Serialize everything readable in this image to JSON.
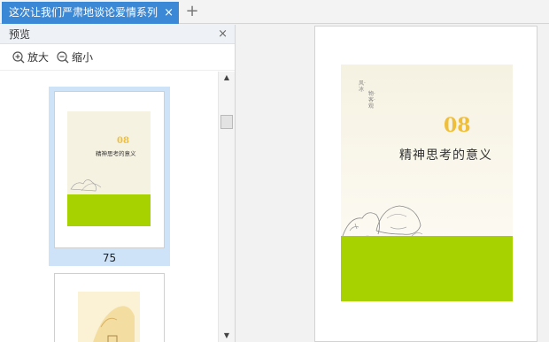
{
  "tabbar": {
    "active_tab_title": "这次让我们严肃地谈论爱情系列",
    "close_glyph": "×",
    "add_glyph": "+"
  },
  "preview_panel": {
    "title": "预览",
    "close_glyph": "×",
    "zoom_in_label": "放大",
    "zoom_out_label": "缩小",
    "pages": [
      {
        "number": "75",
        "selected": true
      },
      {
        "number": "",
        "selected": false
      }
    ]
  },
  "document": {
    "cover_number": "08",
    "cover_title": "精神思考的意义",
    "cover_vertical_text_1": "风·冰",
    "cover_vertical_text_2": "物·客·观"
  },
  "colors": {
    "tab_active": "#3b88d6",
    "selection": "#cfe3f8",
    "cover_green": "#a7d200",
    "cover_number": "#f0bf3a"
  }
}
